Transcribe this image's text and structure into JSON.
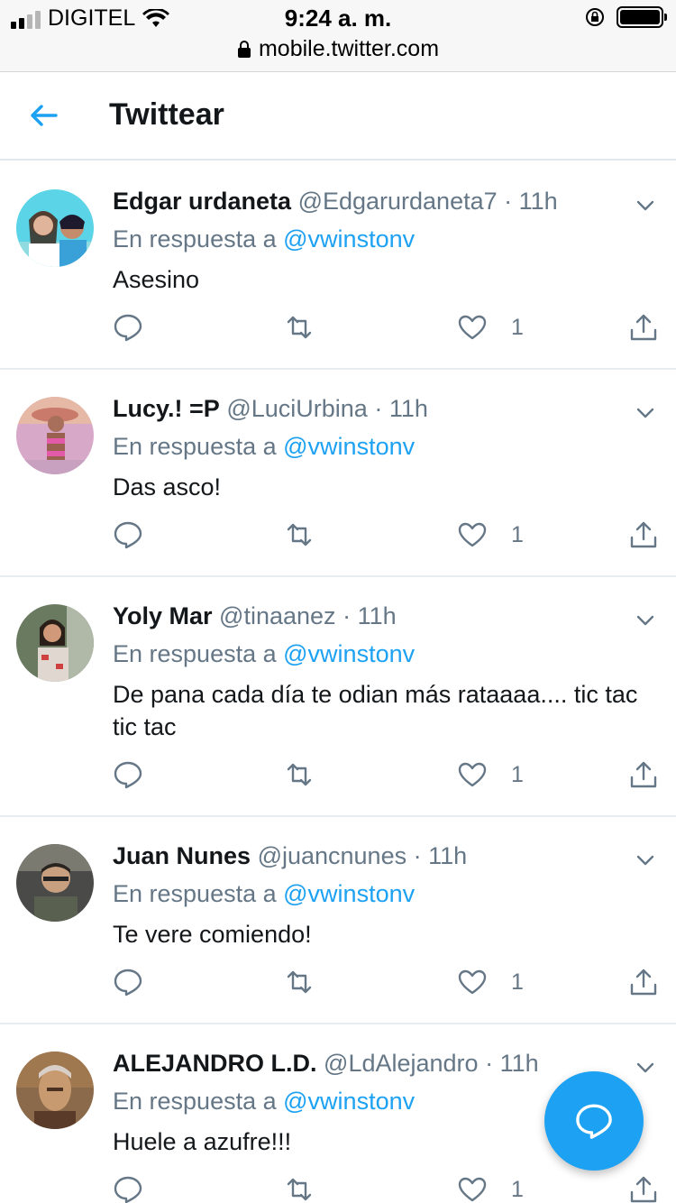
{
  "status_bar": {
    "carrier": "DIGITEL",
    "time": "9:24 a. m.",
    "url": "mobile.twitter.com"
  },
  "header": {
    "title": "Twittear"
  },
  "reply_prefix": "En respuesta a",
  "tweets": [
    {
      "name": "Edgar urdaneta",
      "handle": "@Edgarurdaneta7",
      "time": "11h",
      "reply_to": "@vwinstonv",
      "text": "Asesino",
      "likes": "1"
    },
    {
      "name": "Lucy.! =P",
      "handle": "@LuciUrbina",
      "time": "11h",
      "reply_to": "@vwinstonv",
      "text": "Das asco!",
      "likes": "1"
    },
    {
      "name": "Yoly Mar",
      "handle": "@tinaanez",
      "time": "11h",
      "reply_to": "@vwinstonv",
      "text": "De pana cada día te odian más rataaaa.... tic tac tic tac",
      "likes": "1"
    },
    {
      "name": "Juan Nunes",
      "handle": "@juancnunes",
      "time": "11h",
      "reply_to": "@vwinstonv",
      "text": "Te vere comiendo!",
      "likes": "1"
    },
    {
      "name": "ALEJANDRO L.D.",
      "handle": "@LdAlejandro",
      "time": "11h",
      "reply_to": "@vwinstonv",
      "text": "Huele a azufre!!!",
      "likes": "1"
    }
  ],
  "colors": {
    "accent": "#1da1f2",
    "muted": "#657786",
    "text": "#14171a",
    "divider": "#e6ecf0"
  },
  "icons": [
    "back-arrow-icon",
    "chevron-down-icon",
    "reply-icon",
    "retweet-icon",
    "heart-icon",
    "share-icon",
    "compose-reply-icon"
  ]
}
